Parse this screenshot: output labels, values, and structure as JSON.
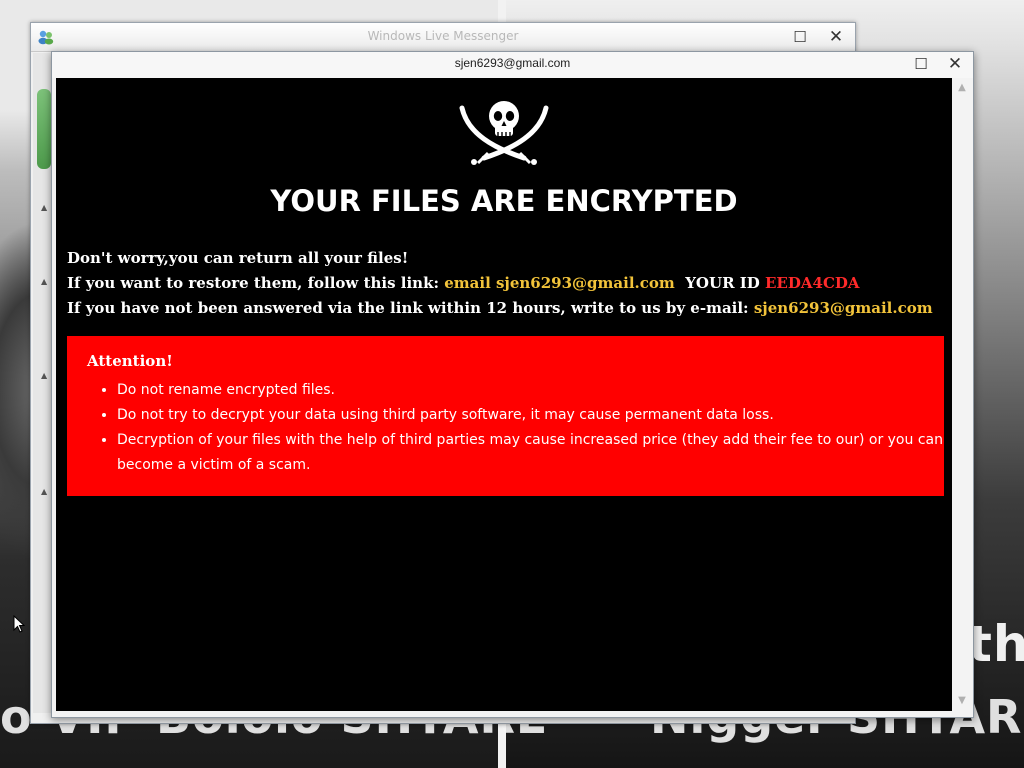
{
  "desktop": {
    "bg_text_left": "o VIP Bololo SHTARL",
    "bg_text_right": "Nigger SHTARL",
    "bg_text_right_top": "tha"
  },
  "back_window": {
    "title": "Windows Live Messenger",
    "maximize_glyph": "☐",
    "close_glyph": "✕"
  },
  "front_window": {
    "title": "sjen6293@gmail.com",
    "maximize_glyph": "☐",
    "close_glyph": "✕"
  },
  "ransom": {
    "headline": "YOUR FILES ARE ENCRYPTED",
    "line1": "Don't worry,you can return all your files!",
    "line2_prefix": "If you want to restore them, follow this link: ",
    "line2_link": "email sjen6293@gmail.com",
    "line2_id_label": "  YOUR ID ",
    "line2_id": "EEDA4CDA",
    "line3_prefix": "If you have not been answered via the link within 12 hours, write to us by e-mail: ",
    "line3_email": "sjen6293@gmail.com",
    "attention_title": "Attention!",
    "attention_items": [
      "Do not rename encrypted files.",
      "Do not try to decrypt your data using third party software, it may cause permanent data loss.",
      "Decryption of your files with the help of third parties may cause increased price (they add their fee to our) or you can become a victim of a scam."
    ]
  },
  "colors": {
    "accent_yellow": "#f2c33a",
    "id_red": "#ff2a2a",
    "attention_bg": "#ff0000",
    "content_bg": "#000000"
  },
  "icons": [
    "messenger-app-icon",
    "pirate-skull-icon",
    "mouse-cursor-icon"
  ]
}
